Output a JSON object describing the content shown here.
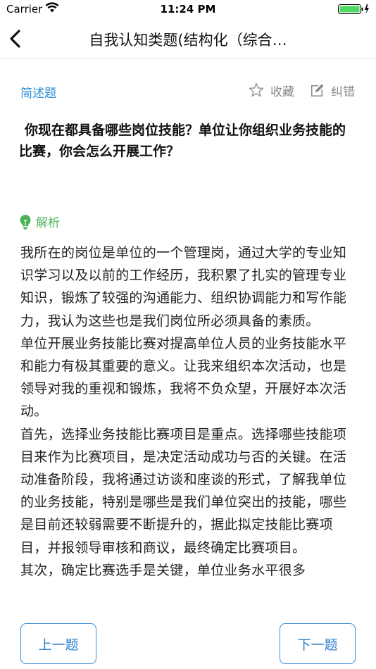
{
  "status_bar": {
    "carrier": "Carrier",
    "time": "11:24 PM"
  },
  "nav": {
    "title": "自我认知类题(结构化（综合…"
  },
  "question_header": {
    "type": "简述题",
    "favorite_label": "收藏",
    "correction_label": "纠错"
  },
  "question": {
    "text": "你现在都具备哪些岗位技能？单位让你组织业务技能的比赛，你会怎么开展工作？"
  },
  "analysis": {
    "heading": "解析",
    "paragraphs": [
      "我所在的岗位是单位的一个管理岗，通过大学的专业知识学习以及以前的工作经历，我积累了扎实的管理专业知识，锻炼了较强的沟通能力、组织协调能力和写作能力，我认为这些也是我们岗位所必须具备的素质。",
      "单位开展业务技能比赛对提高单位人员的业务技能水平和能力有极其重要的意义。让我来组织本次活动，也是领导对我的重视和锻炼，我将不负众望，开展好本次活动。",
      "首先，选择业务技能比赛项目是重点。选择哪些技能项目来作为比赛项目，是决定活动成功与否的关键。在活动准备阶段，我将通过访谈和座谈的形式，了解我单位的业务技能，特别是哪些是我们单位突出的技能，哪些是目前还较弱需要不断提升的，据此拟定技能比赛项目，并报领导审核和商议，最终确定比赛项目。",
      "其次，确定比赛选手是关键，单位业务水平很多"
    ]
  },
  "footer": {
    "prev_label": "上一题",
    "next_label": "下一题"
  },
  "colors": {
    "accent": "#2d8fd5",
    "analysis_green": "#4cb35a",
    "muted": "#888888"
  },
  "icons": [
    "wifi-icon",
    "battery-icon",
    "charging-icon",
    "back-chevron-icon",
    "star-icon",
    "edit-icon",
    "lightbulb-icon"
  ]
}
